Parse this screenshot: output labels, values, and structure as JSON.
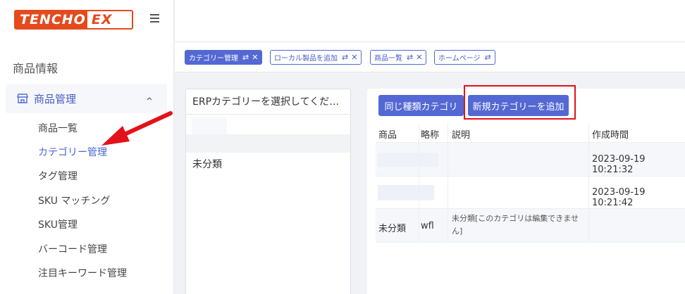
{
  "logo": {
    "part1": "TENCHO",
    "part2": "EX"
  },
  "sidebar": {
    "section_title": "商品情報",
    "group_label": "商品管理",
    "items": [
      {
        "label": "商品一覧",
        "active": false
      },
      {
        "label": "カテゴリー管理",
        "active": true
      },
      {
        "label": "タグ管理",
        "active": false
      },
      {
        "label": "SKU マッチング",
        "active": false
      },
      {
        "label": "SKU管理",
        "active": false
      },
      {
        "label": "バーコード管理",
        "active": false
      },
      {
        "label": "注目キーワード管理",
        "active": false
      }
    ]
  },
  "tabs": [
    {
      "label": "カテゴリー管理",
      "active": true
    },
    {
      "label": "ローカル製品を追加",
      "active": false
    },
    {
      "label": "商品一覧",
      "active": false
    },
    {
      "label": "ホームページ",
      "active": false
    }
  ],
  "left_panel": {
    "select_placeholder": "ERPカテゴリーを選択してくだ…",
    "items": [
      "未分類"
    ]
  },
  "toolbar": {
    "same_category_label": "同じ種類カテゴリ",
    "add_category_label": "新規カテゴリーを追加"
  },
  "table": {
    "headers": [
      "商品",
      "略称",
      "説明",
      "作成時間"
    ],
    "rows": [
      {
        "name": "",
        "abbr": "",
        "desc": "",
        "created": "2023-09-19 10:21:32"
      },
      {
        "name": "",
        "abbr": "",
        "desc": "",
        "created": "2023-09-19 10:21:42"
      },
      {
        "name": "未分類",
        "abbr": "wfl",
        "desc": "未分類[このカテゴリは編集できません]",
        "created": ""
      }
    ]
  },
  "colors": {
    "accent": "#5468d4",
    "logo": "#e5491c",
    "highlight_box": "#e3121a",
    "arrow": "#e3121a"
  }
}
